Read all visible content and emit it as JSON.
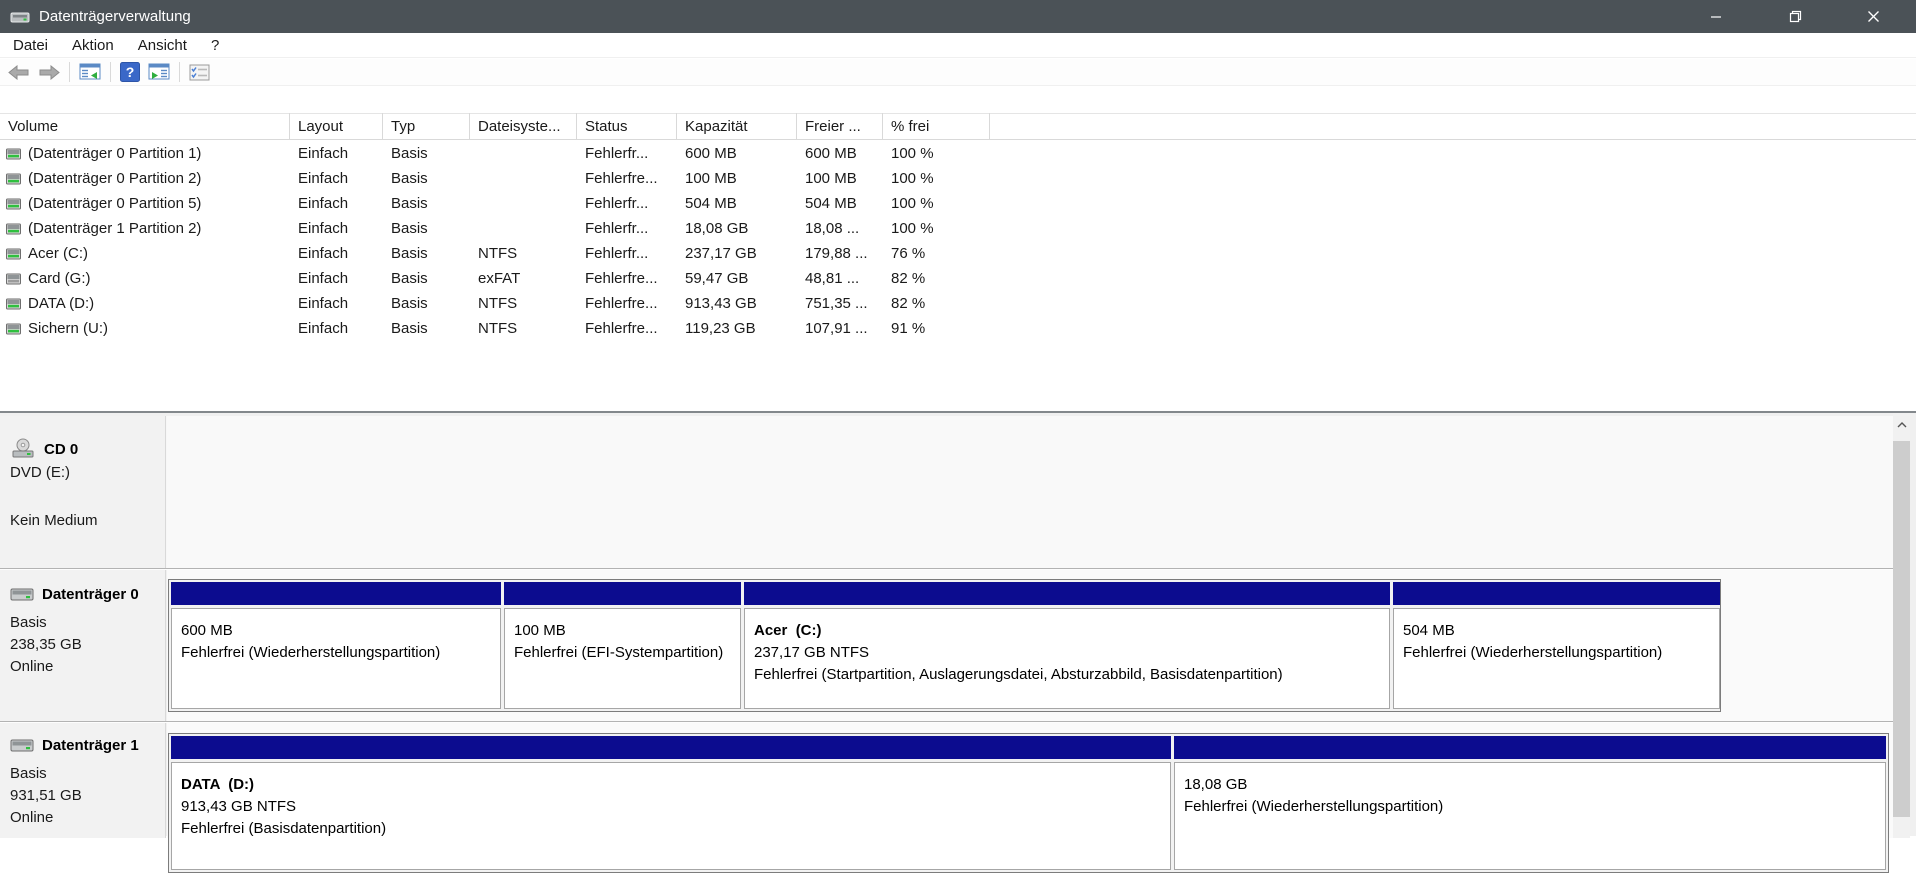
{
  "window": {
    "title": "Datenträgerverwaltung"
  },
  "menubar": {
    "items": [
      "Datei",
      "Aktion",
      "Ansicht",
      "?"
    ]
  },
  "toolbar": {
    "icons": [
      "back",
      "forward",
      "show-console-tree",
      "help",
      "show-action-pane",
      "properties"
    ]
  },
  "table": {
    "headers": [
      "Volume",
      "Layout",
      "Typ",
      "Dateisyste...",
      "Status",
      "Kapazität",
      "Freier ...",
      "% frei"
    ],
    "rows": [
      {
        "volume": "(Datenträger 0 Partition 1)",
        "layout": "Einfach",
        "typ": "Basis",
        "fs": "",
        "status": "Fehlerfr...",
        "kap": "600 MB",
        "frei": "600 MB",
        "pct": "100 %"
      },
      {
        "volume": "(Datenträger 0 Partition 2)",
        "layout": "Einfach",
        "typ": "Basis",
        "fs": "",
        "status": "Fehlerfre...",
        "kap": "100 MB",
        "frei": "100 MB",
        "pct": "100 %"
      },
      {
        "volume": "(Datenträger 0 Partition 5)",
        "layout": "Einfach",
        "typ": "Basis",
        "fs": "",
        "status": "Fehlerfr...",
        "kap": "504 MB",
        "frei": "504 MB",
        "pct": "100 %"
      },
      {
        "volume": "(Datenträger 1 Partition 2)",
        "layout": "Einfach",
        "typ": "Basis",
        "fs": "",
        "status": "Fehlerfr...",
        "kap": "18,08 GB",
        "frei": "18,08 ...",
        "pct": "100 %"
      },
      {
        "volume": "Acer (C:)",
        "layout": "Einfach",
        "typ": "Basis",
        "fs": "NTFS",
        "status": "Fehlerfr...",
        "kap": "237,17 GB",
        "frei": "179,88 ...",
        "pct": "76 %"
      },
      {
        "volume": "Card (G:)",
        "layout": "Einfach",
        "typ": "Basis",
        "fs": "exFAT",
        "status": "Fehlerfre...",
        "kap": "59,47 GB",
        "frei": "48,81 ...",
        "pct": "82 %"
      },
      {
        "volume": "DATA (D:)",
        "layout": "Einfach",
        "typ": "Basis",
        "fs": "NTFS",
        "status": "Fehlerfre...",
        "kap": "913,43 GB",
        "frei": "751,35 ...",
        "pct": "82 %"
      },
      {
        "volume": "Sichern (U:)",
        "layout": "Einfach",
        "typ": "Basis",
        "fs": "NTFS",
        "status": "Fehlerfre...",
        "kap": "119,23 GB",
        "frei": "107,91 ...",
        "pct": "91 %"
      }
    ]
  },
  "bottom": {
    "cd": {
      "title": "CD 0",
      "line1": "DVD (E:)",
      "line2": "Kein Medium"
    },
    "disk0": {
      "title": "Datenträger 0",
      "type": "Basis",
      "size": "238,35 GB",
      "status": "Online",
      "partitions": [
        {
          "title": "",
          "size": "600 MB",
          "status": "Fehlerfrei (Wiederherstellungspartition)"
        },
        {
          "title": "",
          "size": "100 MB",
          "status": "Fehlerfrei (EFI-Systempartition)"
        },
        {
          "title": "Acer  (C:)",
          "size": "237,17 GB NTFS",
          "status": "Fehlerfrei (Startpartition, Auslagerungsdatei, Absturzabbild, Basisdatenpartition)"
        },
        {
          "title": "",
          "size": "504 MB",
          "status": "Fehlerfrei (Wiederherstellungspartition)"
        }
      ]
    },
    "disk1": {
      "title": "Datenträger 1",
      "type": "Basis",
      "size": "931,51 GB",
      "status": "Online",
      "partitions": [
        {
          "title": "DATA  (D:)",
          "size": "913,43 GB NTFS",
          "status": "Fehlerfrei (Basisdatenpartition)"
        },
        {
          "title": "",
          "size": "18,08 GB",
          "status": "Fehlerfrei (Wiederherstellungspartition)"
        }
      ]
    }
  },
  "colors": {
    "titlebar": "#4b5257",
    "partition_primary_bar": "#0c0c8f",
    "help_icon_blue": "#3a68c8",
    "led_green": "#2fbf3f"
  }
}
